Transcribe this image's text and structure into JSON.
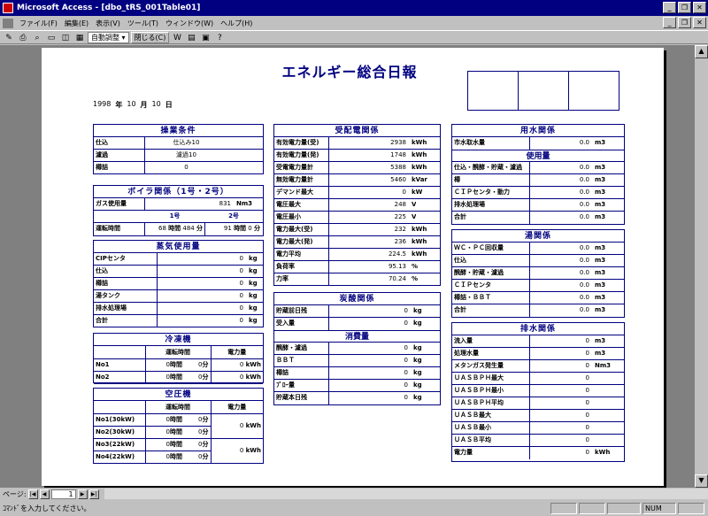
{
  "window": {
    "title": "Microsoft Access - [dbo_tRS_001Table01]"
  },
  "menu": [
    "ファイル(F)",
    "編集(E)",
    "表示(V)",
    "ツール(T)",
    "ウィンドウ(W)",
    "ヘルプ(H)"
  ],
  "toolbar": {
    "zoom": "自動調整",
    "close": "閉じる(C)"
  },
  "report": {
    "title": "エネルギー総合日報",
    "date": {
      "year": "1998",
      "year_u": "年",
      "month": "10",
      "month_u": "月",
      "day": "10",
      "day_u": "日"
    },
    "sousa": {
      "title": "操業条件",
      "rows": [
        {
          "label": "仕込",
          "value": "仕込み10"
        },
        {
          "label": "濾過",
          "value": "濾過10"
        },
        {
          "label": "樽詰",
          "value": "0"
        }
      ]
    },
    "boiler": {
      "title": "ボイラ関係（1号・2号）",
      "gas_label": "ガス使用量",
      "gas_value": "831",
      "gas_unit": "Nm3",
      "col1": "1号",
      "col2": "2号",
      "run_label": "運転時間",
      "h1": "68",
      "jikan1": "時間",
      "m1": "484",
      "fun1": "分",
      "h2": "91",
      "jikan2": "時間",
      "m2": "0",
      "fun2": "分"
    },
    "steam": {
      "title": "蒸気使用量",
      "rows": [
        {
          "label": "CIPセンタ",
          "value": "0",
          "unit": "kg"
        },
        {
          "label": "仕込",
          "value": "0",
          "unit": "kg"
        },
        {
          "label": "樽詰",
          "value": "0",
          "unit": "kg"
        },
        {
          "label": "湯タンク",
          "value": "0",
          "unit": "kg"
        },
        {
          "label": "排水処理場",
          "value": "0",
          "unit": "kg"
        },
        {
          "label": "合計",
          "value": "0",
          "unit": "kg"
        }
      ]
    },
    "reito": {
      "title": "冷凍機",
      "h_run": "運転時間",
      "h_power": "電力量",
      "rows": [
        {
          "label": "No1",
          "h": "0",
          "jikan": "時間",
          "m": "0",
          "fun": "分",
          "p": "0",
          "pu": "kWh"
        },
        {
          "label": "No2",
          "h": "0",
          "jikan": "時間",
          "m": "0",
          "fun": "分",
          "p": "0",
          "pu": "kWh"
        }
      ]
    },
    "kuatsu": {
      "title": "空圧機",
      "h_run": "運転時間",
      "h_power": "電力量",
      "rows": [
        {
          "label": "No1(30kW)",
          "h": "0",
          "jikan": "時間",
          "m": "0",
          "fun": "分"
        },
        {
          "label": "No2(30kW)",
          "h": "0",
          "jikan": "時間",
          "m": "0",
          "fun": "分"
        },
        {
          "label": "No3(22kW)",
          "h": "0",
          "jikan": "時間",
          "m": "0",
          "fun": "分"
        },
        {
          "label": "No4(22kW)",
          "h": "0",
          "jikan": "時間",
          "m": "0",
          "fun": "分"
        }
      ],
      "p12": "0",
      "pu12": "kWh",
      "p34": "0",
      "pu34": "kWh"
    },
    "juhai": {
      "title": "受配電関係",
      "rows": [
        {
          "label": "有効電力量(受)",
          "value": "2938",
          "unit": "kWh"
        },
        {
          "label": "有効電力量(発)",
          "value": "1748",
          "unit": "kWh"
        },
        {
          "label": "受電電力量計",
          "value": "5388",
          "unit": "kWh"
        },
        {
          "label": "無効電力量計",
          "value": "5460",
          "unit": "kVar"
        },
        {
          "label": "デマンド最大",
          "value": "0",
          "unit": "kW"
        },
        {
          "label": "電圧最大",
          "value": "248",
          "unit": "V"
        },
        {
          "label": "電圧最小",
          "value": "225",
          "unit": "V"
        },
        {
          "label": "電力最大(受)",
          "value": "232",
          "unit": "kWh"
        },
        {
          "label": "電力最大(発)",
          "value": "236",
          "unit": "kWh"
        },
        {
          "label": "電力平均",
          "value": "224.5",
          "unit": "kWh"
        },
        {
          "label": "負荷率",
          "value": "95.13",
          "unit": "%"
        },
        {
          "label": "力率",
          "value": "70.24",
          "unit": "%"
        }
      ]
    },
    "tansan": {
      "title": "炭酸関係",
      "rows": [
        {
          "label": "貯蔵前日残",
          "value": "0",
          "unit": "kg"
        },
        {
          "label": "受入量",
          "value": "0",
          "unit": "kg"
        }
      ],
      "sub": "消費量",
      "rows2": [
        {
          "label": "醗酵・濾過",
          "value": "0",
          "unit": "kg"
        },
        {
          "label": "ＢＢＴ",
          "value": "0",
          "unit": "kg"
        },
        {
          "label": "樽詰",
          "value": "0",
          "unit": "kg"
        },
        {
          "label": "ﾌﾟﾛｰ量",
          "value": "0",
          "unit": "kg"
        },
        {
          "label": "貯蔵本日残",
          "value": "0",
          "unit": "kg"
        }
      ]
    },
    "yousui": {
      "title": "用水関係",
      "rows": [
        {
          "label": "市水取水量",
          "value": "0.0",
          "unit": "m3"
        }
      ],
      "sub": "使用量",
      "rows2": [
        {
          "label": "仕込・醗酵・貯蔵・濾過",
          "value": "0.0",
          "unit": "m3"
        },
        {
          "label": "樽",
          "value": "0.0",
          "unit": "m3"
        },
        {
          "label": "ＣＩＰセンタ・動力",
          "value": "0.0",
          "unit": "m3"
        },
        {
          "label": "排水処理場",
          "value": "0.0",
          "unit": "m3"
        },
        {
          "label": "合計",
          "value": "0.0",
          "unit": "m3"
        }
      ]
    },
    "yu": {
      "title": "湯関係",
      "rows": [
        {
          "label": "ＷＣ・ＰＣ回収量",
          "value": "0.0",
          "unit": "m3"
        },
        {
          "label": "仕込",
          "value": "0.0",
          "unit": "m3"
        },
        {
          "label": "醗酵・貯蔵・濾過",
          "value": "0.0",
          "unit": "m3"
        },
        {
          "label": "ＣＩＰセンタ",
          "value": "0.0",
          "unit": "m3"
        },
        {
          "label": "樽詰・ＢＢＴ",
          "value": "0.0",
          "unit": "m3"
        },
        {
          "label": "合計",
          "value": "0.0",
          "unit": "m3"
        }
      ]
    },
    "haisui": {
      "title": "排水関係",
      "rows": [
        {
          "label": "流入量",
          "value": "0",
          "unit": "m3"
        },
        {
          "label": "処理水量",
          "value": "0",
          "unit": "m3"
        },
        {
          "label": "メタンガス発生量",
          "value": "0",
          "unit": "Nm3"
        },
        {
          "label": "ＵＡＳＢＰＨ最大",
          "value": "0",
          "unit": ""
        },
        {
          "label": "ＵＡＳＢＰＨ最小",
          "value": "0",
          "unit": ""
        },
        {
          "label": "ＵＡＳＢＰＨ平均",
          "value": "0",
          "unit": ""
        },
        {
          "label": "ＵＡＳＢ最大",
          "value": "0",
          "unit": ""
        },
        {
          "label": "ＵＡＳＢ最小",
          "value": "0",
          "unit": ""
        },
        {
          "label": "ＵＡＳＢ平均",
          "value": "0",
          "unit": ""
        },
        {
          "label": "電力量",
          "value": "0",
          "unit": "kWh"
        }
      ]
    }
  },
  "nav": {
    "label": "ページ:",
    "page": "1"
  },
  "status": {
    "text": "ｺﾏﾝﾄﾞを入力してください。",
    "num": "NUM"
  }
}
